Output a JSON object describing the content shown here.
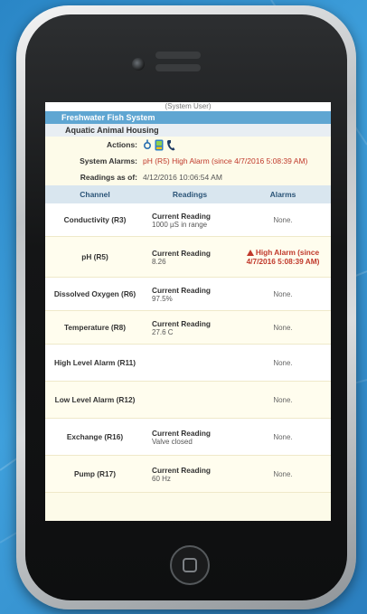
{
  "header": {
    "user_label": "(System User)",
    "system_title": "Freshwater Fish System",
    "section_title": "Aquatic Animal Housing"
  },
  "info": {
    "actions_label": "Actions:",
    "action_icons": [
      "settings-icon",
      "device-icon",
      "phone-icon"
    ],
    "system_alarms_label": "System Alarms:",
    "system_alarms_value": "pH (R5) High Alarm (since 4/7/2016 5:08:39 AM)",
    "readings_as_of_label": "Readings as of:",
    "readings_as_of_value": "4/12/2016 10:06:54 AM"
  },
  "table": {
    "columns": [
      "Channel",
      "Readings",
      "Alarms"
    ],
    "rows": [
      {
        "channel": "Conductivity (R3)",
        "reading_title": "Current Reading",
        "reading_value": "1000 µS in range",
        "alarm": "None."
      },
      {
        "channel": "pH (R5)",
        "reading_title": "Current Reading",
        "reading_value": "8.26",
        "alarm": "High Alarm (since 4/7/2016 5:08:39 AM)"
      },
      {
        "channel": "Dissolved Oxygen (R6)",
        "reading_title": "Current Reading",
        "reading_value": "97.5%",
        "alarm": "None."
      },
      {
        "channel": "Temperature (R8)",
        "reading_title": "Current Reading",
        "reading_value": "27.6 C",
        "alarm": "None."
      },
      {
        "channel": "High Level Alarm (R11)",
        "reading_title": "",
        "reading_value": "",
        "alarm": "None."
      },
      {
        "channel": "Low Level Alarm (R12)",
        "reading_title": "",
        "reading_value": "",
        "alarm": "None."
      },
      {
        "channel": "Exchange (R16)",
        "reading_title": "Current Reading",
        "reading_value": "Valve closed",
        "alarm": "None."
      },
      {
        "channel": "Pump (R17)",
        "reading_title": "Current Reading",
        "reading_value": "60 Hz",
        "alarm": "None."
      }
    ]
  },
  "colors": {
    "accent": "#5fa6d2",
    "alarm": "#c0392b",
    "row_background": "#fffdee"
  }
}
